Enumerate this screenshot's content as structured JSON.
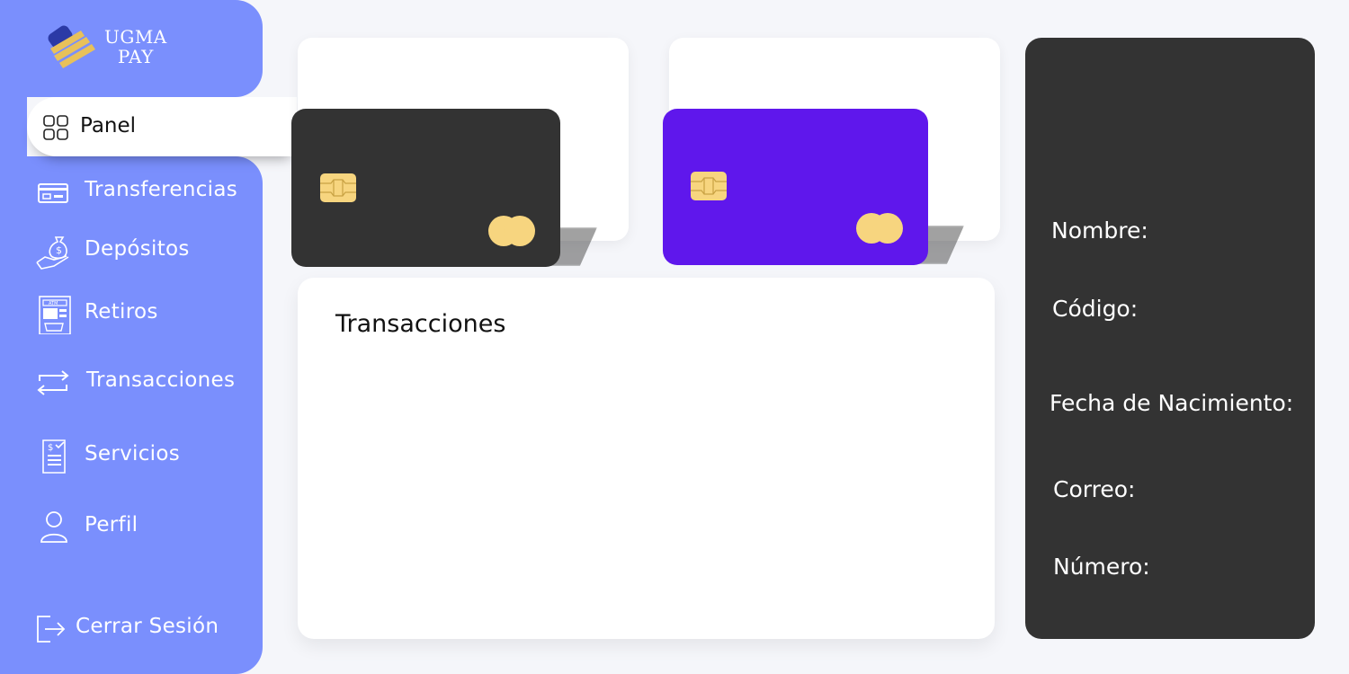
{
  "brand": {
    "line1": "UGMA",
    "line2": "PAY"
  },
  "sidebar": {
    "active": {
      "label": "Panel",
      "icon": "grid-icon"
    },
    "items": [
      {
        "label": "Transferencias",
        "icon": "card-icon"
      },
      {
        "label": "Depósitos",
        "icon": "money-bag-hand-icon"
      },
      {
        "label": "Retiros",
        "icon": "atm-icon"
      },
      {
        "label": "Transacciones",
        "icon": "swap-arrows-icon"
      },
      {
        "label": "Servicios",
        "icon": "bill-icon"
      },
      {
        "label": "Perfil",
        "icon": "user-icon"
      }
    ],
    "logout": {
      "label": "Cerrar Sesión",
      "icon": "logout-icon"
    }
  },
  "cards": [
    {
      "color": "#333333"
    },
    {
      "color": "#5f17ec"
    }
  ],
  "transactions": {
    "title": "Transacciones"
  },
  "profile": {
    "name_label": "Nombre:",
    "code_label": "Código:",
    "birthdate_label": "Fecha de Nacimiento:",
    "email_label": "Correo:",
    "number_label": "Número:"
  },
  "colors": {
    "sidebar": "#7a8ffd",
    "background": "#f5f6fa",
    "profile_panel": "#333333",
    "card_gold": "#f7d57f"
  }
}
